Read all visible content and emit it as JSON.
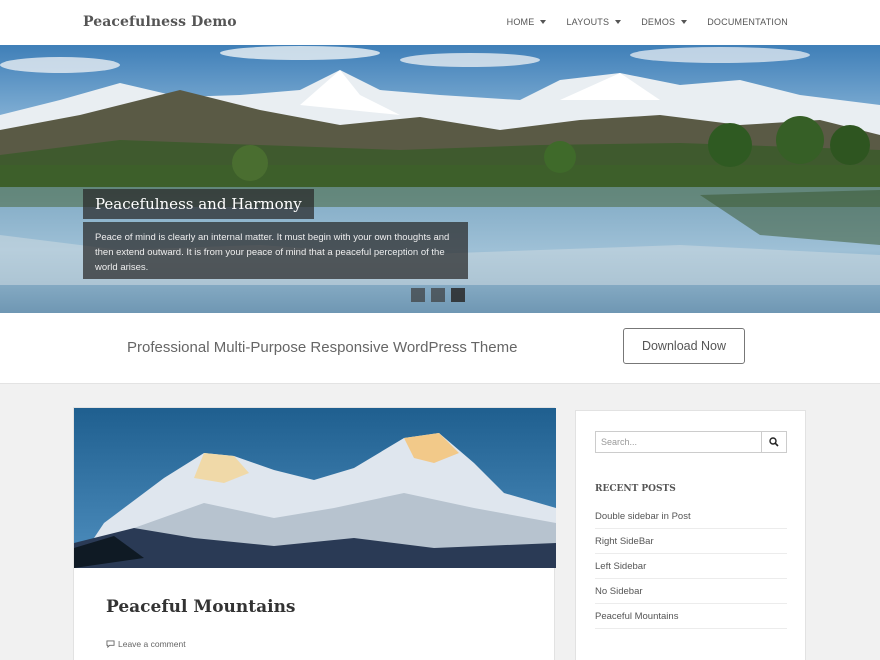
{
  "header": {
    "site_title": "Peacefulness Demo",
    "nav": [
      {
        "label": "HOME",
        "has_dropdown": true
      },
      {
        "label": "LAYOUTS",
        "has_dropdown": true
      },
      {
        "label": "DEMOS",
        "has_dropdown": true
      },
      {
        "label": "DOCUMENTATION",
        "has_dropdown": false
      }
    ]
  },
  "slider": {
    "title": "Peacefulness and Harmony",
    "description": "Peace of mind is clearly an internal matter. It must begin with your own thoughts and then extend outward. It is from your peace of mind that a peaceful perception of the world arises.",
    "active_slide": 3,
    "slide_count": 3
  },
  "callout": {
    "text": "Professional Multi-Purpose Responsive WordPress Theme",
    "button_label": "Download Now"
  },
  "post": {
    "title": "Peaceful Mountains",
    "comment_link": "Leave a comment"
  },
  "sidebar": {
    "search_placeholder": "Search...",
    "recent_posts_title": "RECENT POSTS",
    "recent_posts": [
      "Double sidebar in Post",
      "Right SideBar",
      "Left Sidebar",
      "No Sidebar",
      "Peaceful Mountains"
    ]
  },
  "colors": {
    "header_bg": "#ffffff",
    "page_bg": "#f1f1f1",
    "overlay": "#282828"
  },
  "icons": [
    "chevron-down-icon",
    "search-icon",
    "comment-icon"
  ]
}
